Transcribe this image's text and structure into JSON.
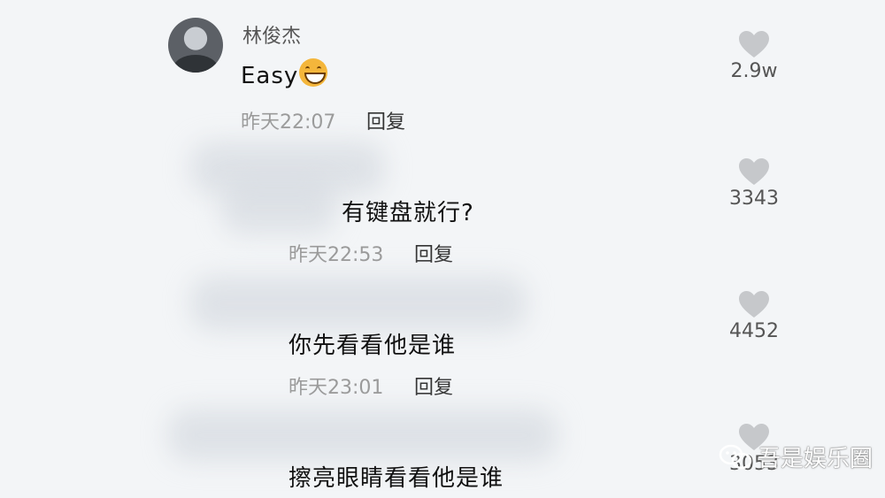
{
  "comments": [
    {
      "author": "林俊杰",
      "text": "Easy",
      "time": "昨天22:07",
      "reply_label": "回复",
      "likes": "2.9w"
    },
    {
      "author": "",
      "text": "有键盘就行?",
      "time": "昨天22:53",
      "reply_label": "回复",
      "likes": "3343"
    },
    {
      "author": "",
      "text": "你先看看他是谁",
      "time": "昨天23:01",
      "reply_label": "回复",
      "likes": "4452"
    },
    {
      "author": "",
      "text": "擦亮眼睛看看他是谁",
      "time": "",
      "reply_label": "",
      "likes": "3053"
    }
  ],
  "icons": {
    "like": "heart-icon",
    "emoji": "grinning-emoji-icon",
    "watermark": "wechat-icon"
  },
  "watermark": {
    "text": "吾是娱乐圈"
  },
  "colors": {
    "background": "#f3f5f7",
    "heart": "#c6c8cb",
    "meta": "#9a9a9a"
  }
}
